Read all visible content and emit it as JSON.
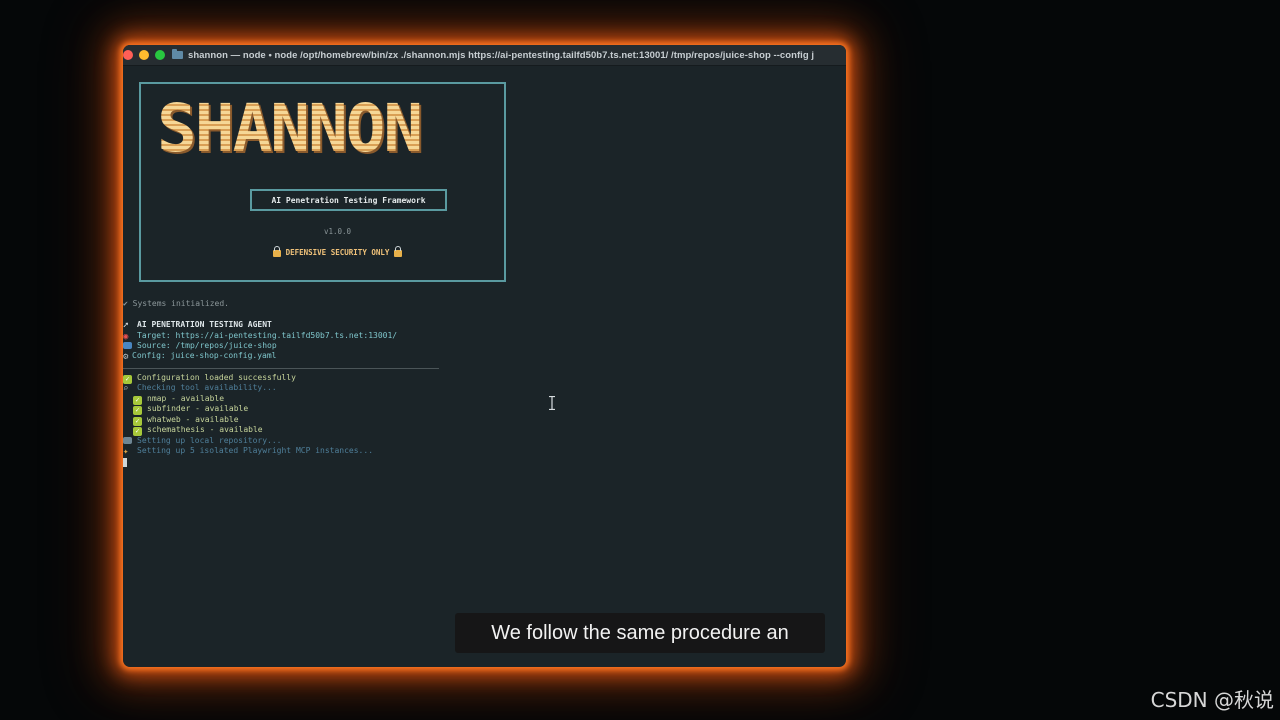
{
  "window": {
    "title": "shannon — node • node /opt/homebrew/bin/zx ./shannon.mjs https://ai-pentesting.tailfd50b7.ts.net:13001/ /tmp/repos/juice-shop --config j",
    "traffic_lights": [
      "#ff5f57",
      "#febc2e",
      "#28c840"
    ]
  },
  "banner": {
    "logo": "SHANNON",
    "subtitle": "AI Penetration Testing Framework",
    "version": "v1.0.0",
    "defensive": "DEFENSIVE SECURITY ONLY"
  },
  "output": {
    "systems": "✔ Systems initialized.",
    "agent_title": "AI PENETRATION TESTING AGENT",
    "target": "Target: https://ai-pentesting.tailfd50b7.ts.net:13001/",
    "source": "Source: /tmp/repos/juice-shop",
    "config": "Config: juice-shop-config.yaml",
    "config_loaded": "Configuration loaded successfully",
    "checking_tools": "Checking tool availability...",
    "tools": [
      "nmap - available",
      "subfinder - available",
      "whatweb - available",
      "schemathesis - available"
    ],
    "local_repo": "Setting up local repository...",
    "playwright": "Setting up 5 isolated Playwright MCP instances..."
  },
  "caption": "We follow the same procedure an",
  "watermark": "CSDN @秋说",
  "colors": {
    "glow": "#ff7622",
    "terminal_bg": "#1b2428",
    "accent_teal": "#5a9aa0",
    "logo_gold": "#f2c77b"
  }
}
